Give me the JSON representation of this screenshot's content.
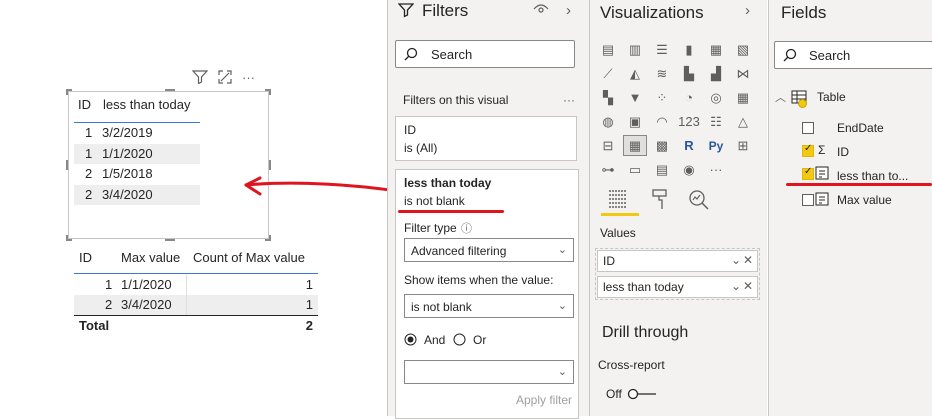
{
  "canvas": {
    "table1": {
      "headers": [
        "ID",
        "less than today"
      ],
      "rows": [
        [
          "1",
          "3/2/2019"
        ],
        [
          "1",
          "1/1/2020"
        ],
        [
          "2",
          "1/5/2018"
        ],
        [
          "2",
          "3/4/2020"
        ]
      ]
    },
    "table2": {
      "headers": [
        "ID",
        "Max value",
        "Count of Max value"
      ],
      "rows": [
        [
          "1",
          "1/1/2020",
          "1"
        ],
        [
          "2",
          "3/4/2020",
          "1"
        ]
      ],
      "total_label": "Total",
      "total_value": "2"
    },
    "header_icons": [
      "filter-icon",
      "focus-mode-icon",
      "more-options-icon"
    ]
  },
  "filters": {
    "title": "Filters",
    "search_placeholder": "Search",
    "section_label": "Filters on this visual",
    "more": "···",
    "card1": {
      "field": "ID",
      "state": "is (All)"
    },
    "card2": {
      "field": "less than today",
      "state": "is not blank",
      "filter_type_label": "Filter type",
      "filter_type_value": "Advanced filtering",
      "show_items_label": "Show items when the value:",
      "condition_value": "is not blank",
      "and_label": "And",
      "or_label": "Or",
      "apply_label": "Apply filter"
    }
  },
  "visualizations": {
    "title": "Visualizations",
    "values_label": "Values",
    "wells": [
      "ID",
      "less than today"
    ],
    "drill_through_label": "Drill through",
    "cross_report_label": "Cross-report",
    "toggle_label": "Off"
  },
  "fields": {
    "title": "Fields",
    "search_placeholder": "Search",
    "table_name": "Table",
    "items": [
      {
        "name": "EndDate",
        "checked": false
      },
      {
        "name": "ID",
        "checked": true
      },
      {
        "name": "less than to...",
        "checked": true
      },
      {
        "name": "Max value",
        "checked": false
      }
    ]
  },
  "colors": {
    "accent_yellow": "#f2c811",
    "annotation_red": "#e0141e",
    "pane_bg": "#f3f2f1",
    "table_rule_blue": "#3c78d8"
  }
}
